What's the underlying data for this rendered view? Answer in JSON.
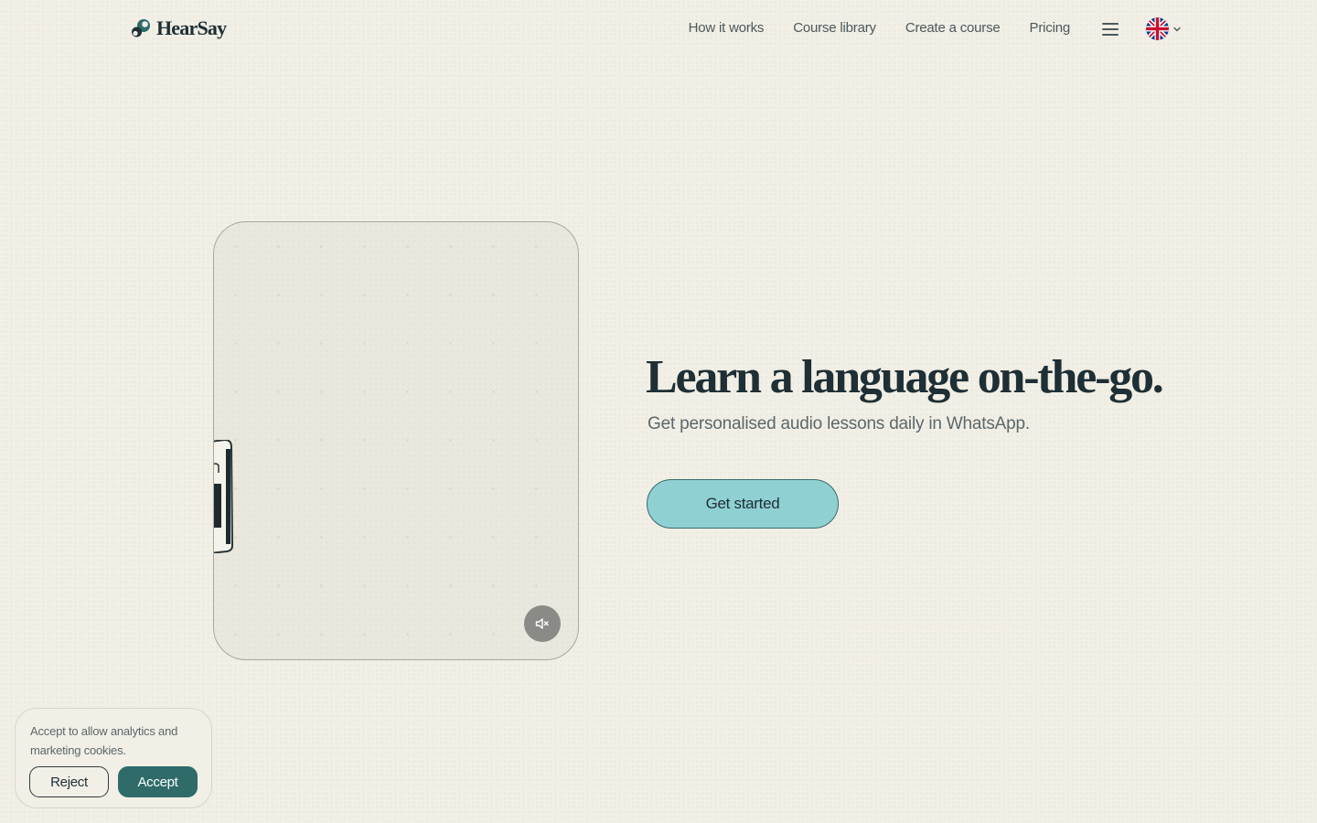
{
  "brand": {
    "name": "HearSay",
    "accent": "#2e6b69"
  },
  "nav": {
    "items": [
      {
        "label": "How it works"
      },
      {
        "label": "Course library"
      },
      {
        "label": "Create a course"
      },
      {
        "label": "Pricing"
      }
    ],
    "menu_icon": "hamburger-menu-icon",
    "language_icon": "uk-flag-icon"
  },
  "hero": {
    "title": "Learn a language on-the-go.",
    "subtitle": "Get personalised audio lessons daily in WhatsApp.",
    "cta_label": "Get started",
    "cta_color": "#8fd0d2"
  },
  "video": {
    "mute_icon": "speaker-muted-icon"
  },
  "cookies": {
    "message": "Accept to allow analytics and marketing cookies.",
    "reject_label": "Reject",
    "accept_label": "Accept"
  }
}
